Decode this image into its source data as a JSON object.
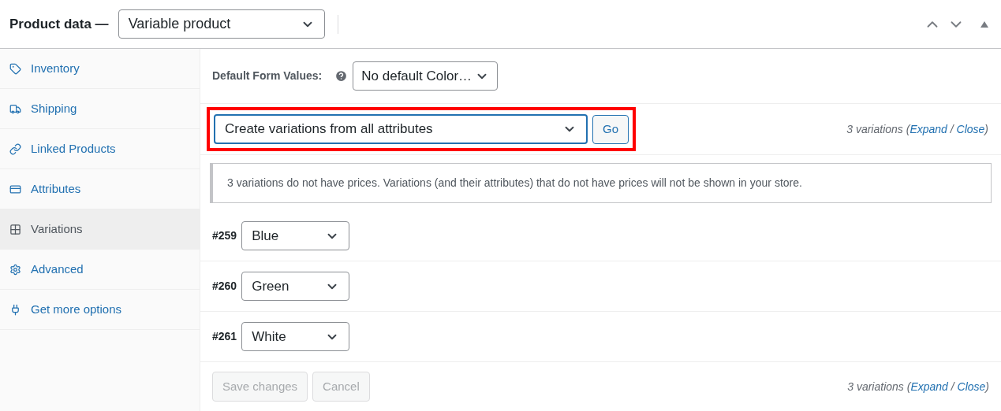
{
  "header": {
    "title": "Product data —",
    "product_type": "Variable product"
  },
  "sidebar": {
    "items": [
      {
        "label": "Inventory",
        "kind": "tag",
        "selected": false
      },
      {
        "label": "Shipping",
        "kind": "truck",
        "selected": false
      },
      {
        "label": "Linked Products",
        "kind": "link",
        "selected": false
      },
      {
        "label": "Attributes",
        "kind": "card",
        "selected": false
      },
      {
        "label": "Variations",
        "kind": "grid",
        "selected": true
      },
      {
        "label": "Advanced",
        "kind": "gear",
        "selected": false
      },
      {
        "label": "Get more options",
        "kind": "plug",
        "selected": false
      }
    ]
  },
  "defaults": {
    "label": "Default Form Values:",
    "value": "No default Color…"
  },
  "bulk": {
    "action": "Create variations from all attributes",
    "button": "Go",
    "highlighted": true
  },
  "summary_top": {
    "prefix": "3 variations (",
    "expand": "Expand",
    "separator": " / ",
    "close": "Close",
    "suffix": ")"
  },
  "notice": "3 variations do not have prices. Variations (and their attributes) that do not have prices will not be shown in your store.",
  "variations": [
    {
      "id": "#259",
      "value": "Blue"
    },
    {
      "id": "#260",
      "value": "Green"
    },
    {
      "id": "#261",
      "value": "White"
    }
  ],
  "footer": {
    "save": "Save changes",
    "cancel": "Cancel",
    "save_disabled": true,
    "cancel_disabled": true
  },
  "summary_bottom": {
    "prefix": "3 variations (",
    "expand": "Expand",
    "separator": " / ",
    "close": "Close",
    "suffix": ")"
  }
}
